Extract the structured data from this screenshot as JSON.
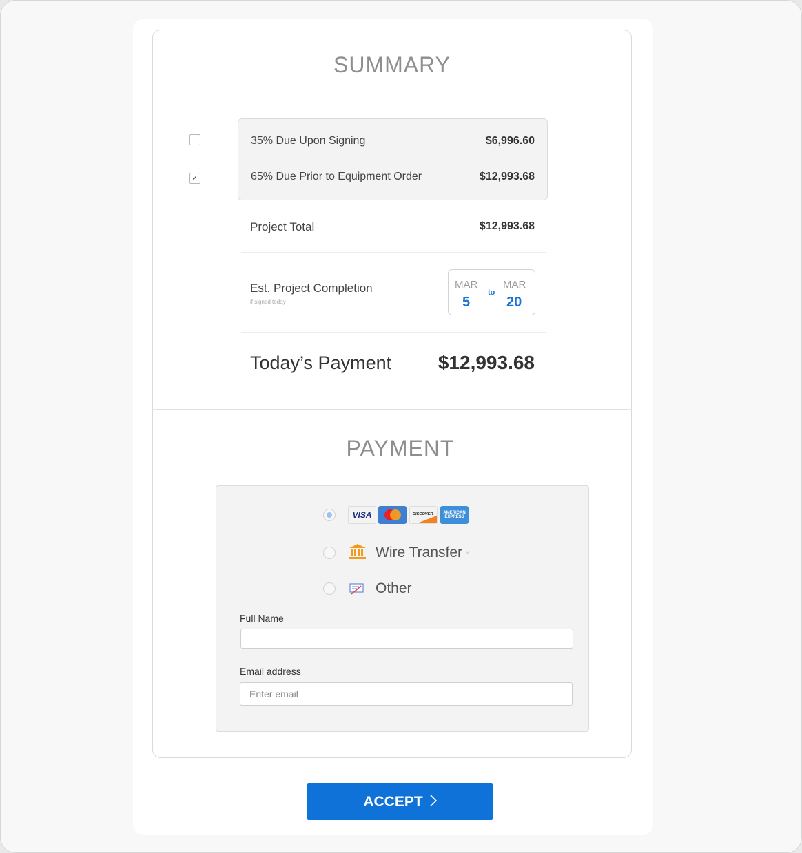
{
  "summary": {
    "title": "SUMMARY",
    "installments": [
      {
        "label": "35% Due Upon Signing",
        "amount": "$6,996.60",
        "checked": false
      },
      {
        "label": "65% Due Prior to Equipment Order",
        "amount": "$12,993.68",
        "checked": true
      }
    ],
    "project_total_label": "Project Total",
    "project_total_value": "$12,993.68",
    "completion_label": "Est. Project Completion",
    "completion_note": "if signed today",
    "completion_start_month": "MAR",
    "completion_start_day": "5",
    "completion_to": "to",
    "completion_end_month": "MAR",
    "completion_end_day": "20",
    "todays_payment_label": "Today’s Payment",
    "todays_payment_value": "$12,993.68"
  },
  "payment": {
    "title": "PAYMENT",
    "card_logos": [
      "VISA",
      "MasterCard",
      "DISCOVER",
      "AMERICAN EXPRESS"
    ],
    "wire_transfer_label": "Wire Transfer",
    "other_label": "Other",
    "full_name_label": "Full Name",
    "full_name_value": "",
    "email_label": "Email address",
    "email_placeholder": "Enter email"
  },
  "accept_label": "ACCEPT",
  "colors": {
    "accent": "#0f72d8",
    "date_blue": "#1a73d8",
    "wire_icon": "#f29a1a"
  }
}
